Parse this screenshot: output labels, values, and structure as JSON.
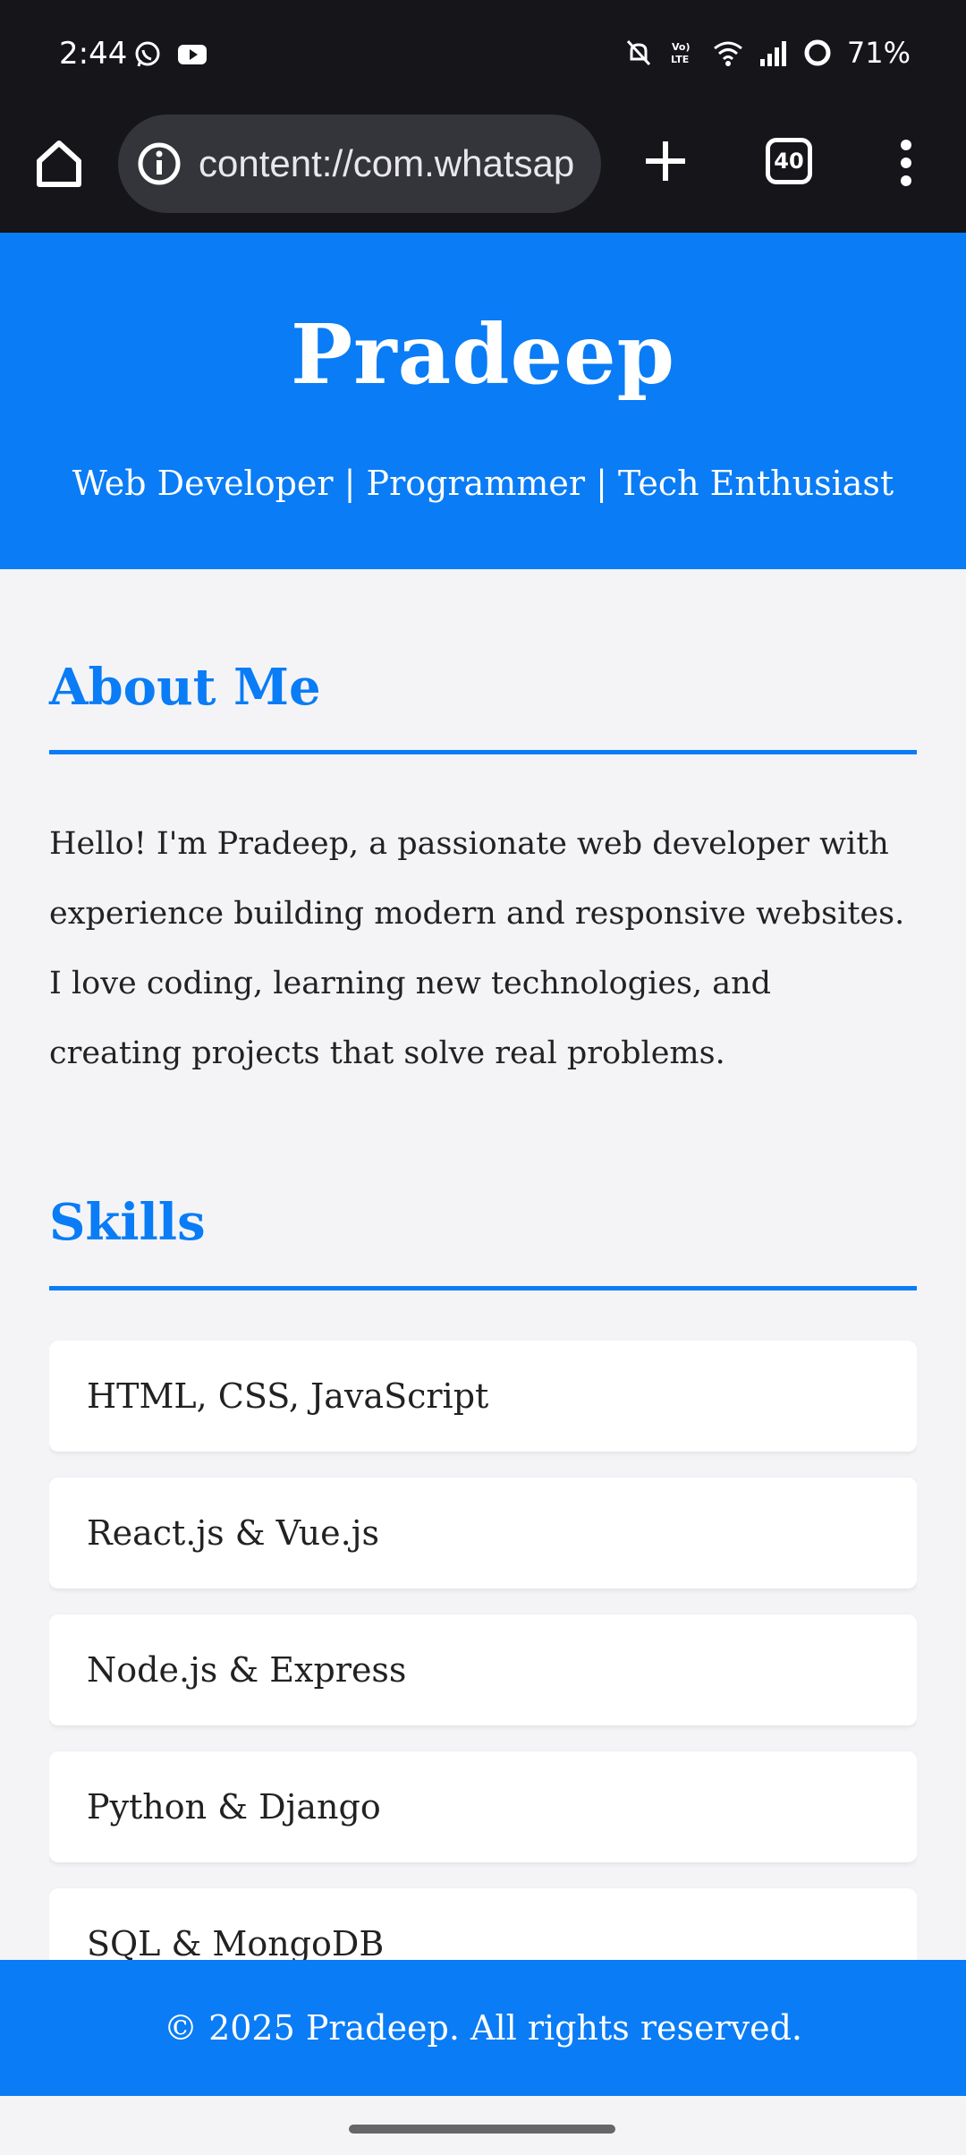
{
  "status_bar": {
    "time": "2:44",
    "battery": "71%",
    "network_badge": "Vo) LTE",
    "icons": [
      "whatsapp-icon",
      "youtube-icon",
      "mute-icon",
      "volte-icon",
      "wifi-icon",
      "signal-icon",
      "battery-icon"
    ]
  },
  "browser": {
    "url": "content://com.whatsap",
    "tab_count": "40",
    "icons": [
      "home-icon",
      "info-icon",
      "plus-icon",
      "more-vert-icon"
    ]
  },
  "hero": {
    "title": "Pradeep",
    "subtitle": "Web Developer | Programmer | Tech Enthusiast"
  },
  "about": {
    "heading": "About Me",
    "text": "Hello! I'm Pradeep, a passionate web developer with experience building modern and responsive websites. I love coding, learning new technologies, and creating projects that solve real problems."
  },
  "skills": {
    "heading": "Skills",
    "items": [
      "HTML, CSS, JavaScript",
      "React.js & Vue.js",
      "Node.js & Express",
      "Python & Django",
      "SQL & MongoDB"
    ]
  },
  "footer": {
    "text": "© 2025 Pradeep. All rights reserved."
  },
  "colors": {
    "accent": "#0a7cf5",
    "browser_chrome": "#15151a",
    "page_background": "#f4f4f7"
  }
}
